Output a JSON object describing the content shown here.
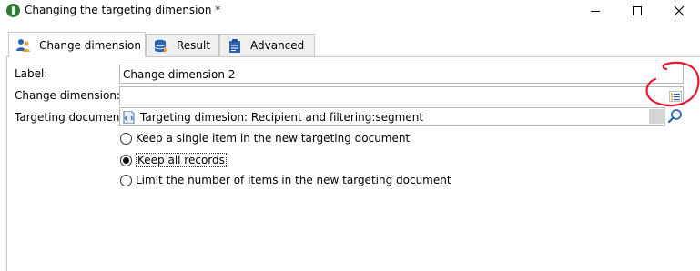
{
  "window": {
    "title": "Changing the targeting dimension *"
  },
  "tabs": [
    {
      "label": "Change dimension",
      "icon": "change-dimension-icon",
      "active": true
    },
    {
      "label": "Result",
      "icon": "database-icon",
      "active": false
    },
    {
      "label": "Advanced",
      "icon": "clipboard-icon",
      "active": false
    }
  ],
  "form": {
    "label_caption": "Label:",
    "label_value": "Change dimension 2",
    "change_dimension_caption": "Change dimension:",
    "change_dimension_value": "",
    "targeting_document_caption": "Targeting document:",
    "targeting_document_value": "Targeting dimesion: Recipient and filtering:segment"
  },
  "options": {
    "items": [
      {
        "label": "Keep a single item in the new targeting document",
        "checked": false
      },
      {
        "label": "Keep all records",
        "checked": true
      },
      {
        "label": "Limit the number of items in the new targeting document",
        "checked": false
      }
    ]
  },
  "colors": {
    "annotation_circle": "#e8192c",
    "app_icon": "#2f7a3a",
    "tab_border": "#c9c9c9"
  }
}
